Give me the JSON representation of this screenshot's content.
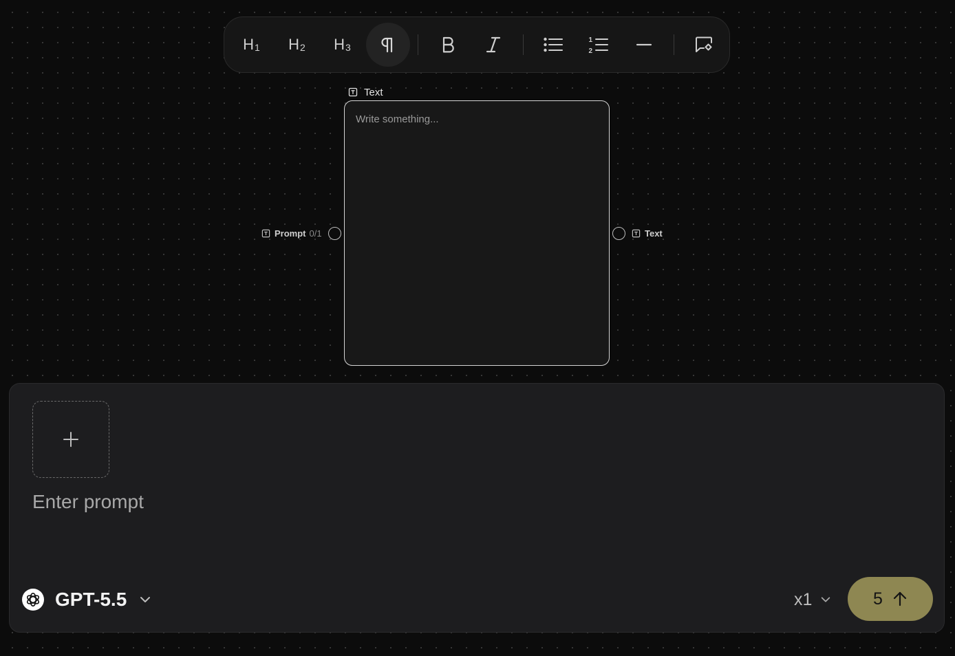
{
  "toolbar": {
    "items": [
      {
        "name": "heading-1",
        "label": "H",
        "sub": "1"
      },
      {
        "name": "heading-2",
        "label": "H",
        "sub": "2"
      },
      {
        "name": "heading-3",
        "label": "H",
        "sub": "3"
      }
    ],
    "icons": [
      "pilcrow-icon",
      "bold-icon",
      "italic-icon",
      "bullet-list-icon",
      "numbered-list-icon",
      "horizontal-rule-icon",
      "comment-icon"
    ],
    "active": "paragraph"
  },
  "node": {
    "title": "Text",
    "placeholder": "Write something...",
    "input_port": {
      "label": "Prompt",
      "count": "0/1"
    },
    "output_port": {
      "label": "Text"
    }
  },
  "prompt": {
    "placeholder": "Enter prompt",
    "model": "GPT-5.5",
    "quantity": "x1",
    "cost": "5"
  },
  "colors": {
    "background": "#0c0c0c",
    "panel": "#1d1d1f",
    "run_button": "#8e8752"
  }
}
